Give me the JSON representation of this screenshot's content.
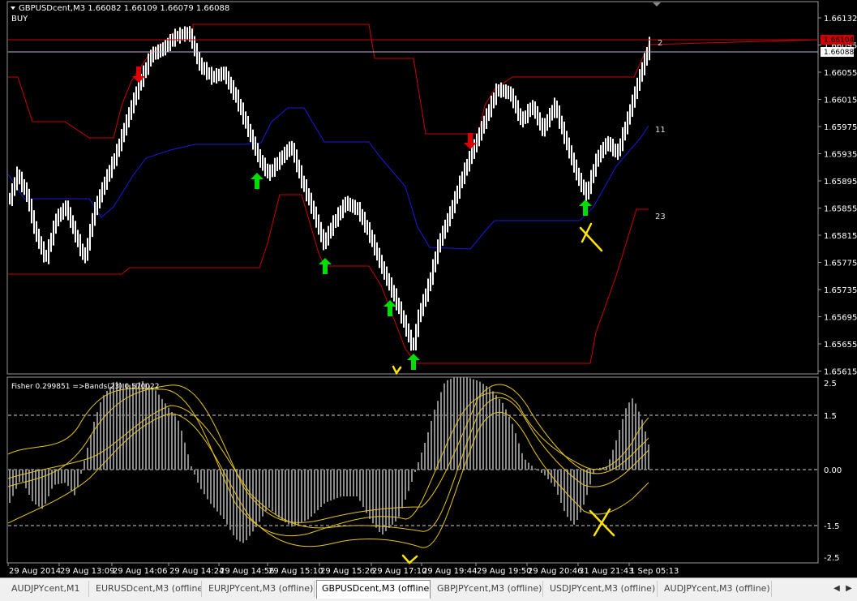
{
  "window": {
    "symbol_line": "GBPUSDcent,M3  1.66082 1.66109 1.66079 1.66088",
    "signal": "BUY"
  },
  "price_axis": {
    "ticks": [
      "1.66132",
      "1.66095",
      "1.66055",
      "1.66015",
      "1.65975",
      "1.65935",
      "1.65895",
      "1.65855",
      "1.65815",
      "1.65775",
      "1.65735",
      "1.65695",
      "1.65655",
      "1.65615"
    ],
    "red_label": "1.66104",
    "white_label": "1.66088"
  },
  "level_labels": {
    "top": "2",
    "mid": "11",
    "low": "23"
  },
  "indicator": {
    "title": "Fisher 0.299851  =>Bands(23) 0.570022",
    "ticks": [
      "2.5",
      "1.5",
      "0.00",
      "-1.5",
      "-2.5"
    ]
  },
  "time_axis": [
    "29 Aug 2014",
    "29 Aug 13:09",
    "29 Aug 14:06",
    "29 Aug 14:24",
    "29 Aug 14:56",
    "29 Aug 15:10",
    "29 Aug 15:26",
    "29 Aug 17:10",
    "29 Aug 19:44",
    "29 Aug 19:50",
    "29 Aug 20:46",
    "31 Aug 21:43",
    "1 Sep 05:13"
  ],
  "tabs": [
    {
      "label": "AUDJPYcent,M1",
      "active": false
    },
    {
      "label": "EURUSDcent,M3 (offline)",
      "active": false
    },
    {
      "label": "EURJPYcent,M3 (offline)",
      "active": false
    },
    {
      "label": "GBPUSDcent,M3 (offline)",
      "active": true
    },
    {
      "label": "GBPJPYcent,M3 (offline)",
      "active": false
    },
    {
      "label": "USDJPYcent,M3 (offline)",
      "active": false
    },
    {
      "label": "AUDJPYcent,M3 (offline)",
      "active": false
    }
  ],
  "tab_nav": {
    "prev": "◀",
    "next": "▶"
  },
  "colors": {
    "background": "#000000",
    "candle": "#ffffff",
    "upper_band": "#cc0000",
    "lower_band": "#cc0000",
    "mid_band": "#1a1adc",
    "histogram": "#8c8c8c",
    "fisher_bands": "#e6c619",
    "arrow_up": "#00dd00",
    "arrow_down": "#dd0000",
    "annotation": "#ffe600"
  }
}
